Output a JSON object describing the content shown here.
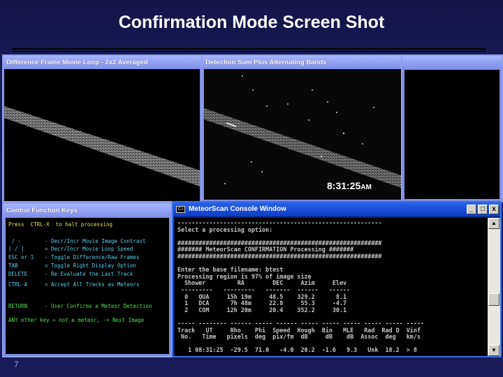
{
  "slide": {
    "title": "Confirmation Mode Screen Shot",
    "page_number": "7"
  },
  "panels": {
    "left_title": "Difference Frame Movie Loop - 2x2 Averaged",
    "middle_title": "Detection Sum Plus Alternating Bands",
    "right_title": "",
    "clock_time": "8:31:25",
    "clock_ampm": "AM",
    "keys_title": "Control Function Keys"
  },
  "control_keys": [
    {
      "key": "Press  CTRL-X  to halt processing",
      "desc": "",
      "style": "y"
    },
    {
      "key": " / -",
      "desc": "- Decr/Incr Movie Image Contrast",
      "style": "b"
    },
    {
      "key": "[ / ]",
      "desc": "= Decr/Incr Movie Loop Speed",
      "style": "b"
    },
    {
      "key": "ESC or 1",
      "desc": "- Toggle Difference/Raw Frames",
      "style": "b"
    },
    {
      "key": "TAB",
      "desc": "= Toggle Right Display Option",
      "style": "b"
    },
    {
      "key": "DELETE",
      "desc": "- Re Evaluate the Last Track",
      "style": "b"
    },
    {
      "key": "CTRL-A",
      "desc": "= Accept All Tracks as Meteors",
      "style": "b"
    },
    {
      "key": "RETURN",
      "desc": "- User Confirms a Meteor Detection",
      "style": "g"
    },
    {
      "key": "ANY other key = not a meteor, -> Next Image",
      "desc": "",
      "style": "g"
    }
  ],
  "console": {
    "title": "MeteorScan Console Window",
    "buttons": [
      "_",
      "□",
      "x"
    ],
    "lines": [
      "----------------------------------------------------------",
      "Select a processing option:",
      "",
      "##########################################################",
      "####### MeteorScan CONFIRMATION Processing #######",
      "##########################################################",
      "",
      "Enter the base filename: btest",
      "Processing region is 97% of image size",
      "  Shower         RA        DEC     Azim     Elev",
      " ---------   ---------   -------  ------   ------",
      "  0   QUA     15h 19m     48.5    329.2      8.1",
      "  1   DCA      7h 48m     22.8     55.3     -4.7",
      "  2   COM     12h 20m     20.4    352.2     30.1",
      "",
      "----- -------- ------ ----- ------ ----- ----- ----- ----- ----- -----",
      "Track   UT     Rho    Phi  Speed  Hough  Bin   MLE   Rad  Rad D  Vinf",
      " No.   Time   pixels  deg  pix/fm  dB     dB    dB  Assoc  deg   km/s",
      "",
      "   1 08:31:25  -29.5  71.0   -4.0  20.2  -1.6   9.3   Unk  18.2  > 8"
    ]
  }
}
